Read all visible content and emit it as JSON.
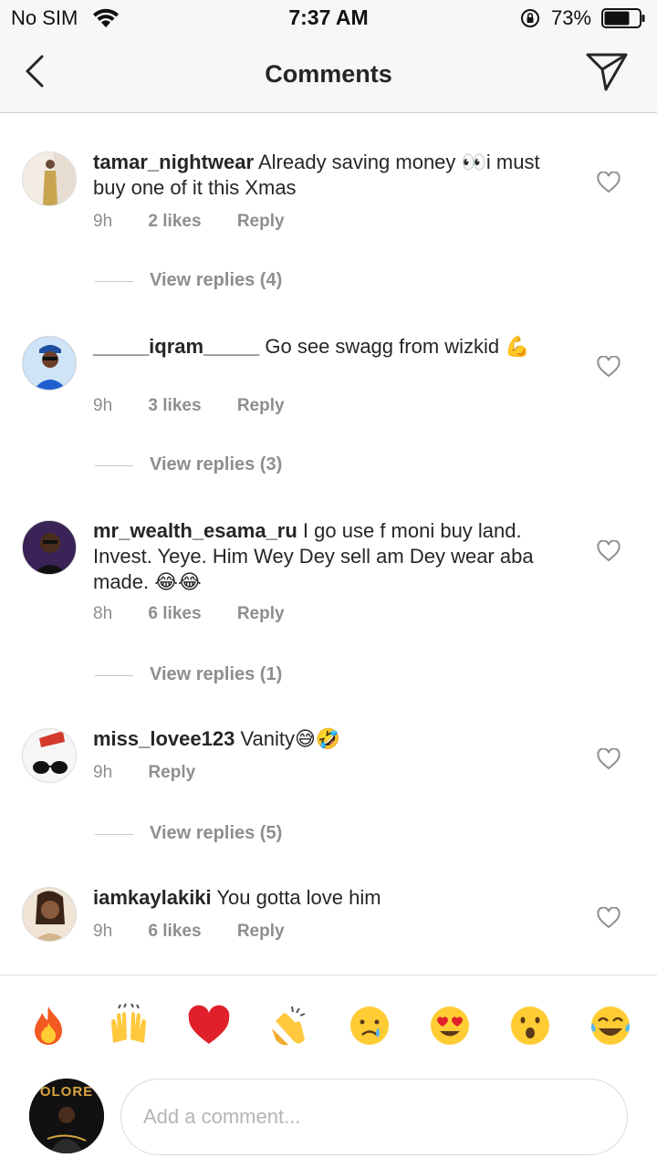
{
  "status_bar": {
    "carrier": "No SIM",
    "time": "7:37 AM",
    "battery": "73%",
    "battery_level": 0.73
  },
  "header": {
    "title": "Comments"
  },
  "comments": [
    {
      "username": "tamar_nightwear",
      "text": "Already saving money 👀i must buy one of it this Xmas",
      "time": "9h",
      "likes": "2 likes",
      "reply": "Reply",
      "view_replies": "View replies (4)"
    },
    {
      "username": "_____iqram_____",
      "text": "Go see swagg from wizkid 💪",
      "time": "9h",
      "likes": "3 likes",
      "reply": "Reply",
      "view_replies": "View replies (3)"
    },
    {
      "username": "mr_wealth_esama_ru",
      "text": "I go use f moni buy land. Invest. Yeye.  Him Wey Dey sell am Dey wear aba made. 😂😂",
      "time": "8h",
      "likes": "6 likes",
      "reply": "Reply",
      "view_replies": "View replies (1)"
    },
    {
      "username": "miss_lovee123",
      "text": "Vanity😅🤣",
      "time": "9h",
      "likes": "",
      "reply": "Reply",
      "view_replies": "View replies (5)"
    },
    {
      "username": "iamkaylakiki",
      "text": "You gotta love him",
      "time": "9h",
      "likes": "6 likes",
      "reply": "Reply",
      "view_replies": ""
    }
  ],
  "emoji_bar": {
    "emojis": [
      "🔥",
      "🙌",
      "❤️",
      "👏",
      "😢",
      "😍",
      "😮",
      "😂"
    ]
  },
  "composer": {
    "placeholder": "Add a comment...",
    "avatar_text": "OLORE"
  }
}
